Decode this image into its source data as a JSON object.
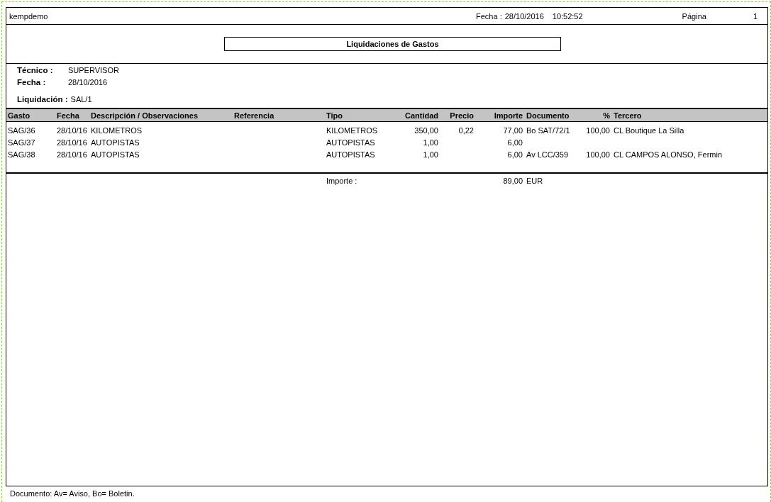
{
  "header": {
    "company": "kempdemo",
    "date_label": "Fecha :",
    "date": "28/10/2016",
    "time": "10:52:52",
    "page_label": "Página",
    "page": "1"
  },
  "title": "Liquidaciones de Gastos",
  "info": [
    {
      "label": "Técnico :",
      "value": "SUPERVISOR"
    },
    {
      "label": "Fecha :",
      "value": "28/10/2016"
    },
    {
      "label": "Liquidación :",
      "value": "SAL/1"
    }
  ],
  "table": {
    "columns": [
      "Gasto",
      "Fecha",
      "Descripción / Observaciones",
      "Referencia",
      "Tipo",
      "Cantidad",
      "Precio",
      "Importe",
      "Documento",
      "%",
      "Tercero"
    ],
    "rows": [
      [
        "SAG/36",
        "28/10/16",
        "KILOMETROS",
        null,
        "KILOMETROS",
        "350,00",
        "0,22",
        "77,00",
        "Bo SAT/72/1",
        "100,00",
        "CL Boutique La Silla"
      ],
      [
        "SAG/37",
        "28/10/16",
        "AUTOPISTAS",
        null,
        "AUTOPISTAS",
        "1,00",
        null,
        "6,00",
        null,
        null,
        null
      ],
      [
        "SAG/38",
        "28/10/16",
        "AUTOPISTAS",
        null,
        "AUTOPISTAS",
        "1,00",
        null,
        "6,00",
        "Av LCC/359",
        "100,00",
        "CL CAMPOS ALONSO, Fermin"
      ]
    ]
  },
  "total": {
    "label": "Importe :",
    "amount": "89,00",
    "currency": "EUR"
  },
  "footnote": "Documento: Av= Aviso, Bo= Boletin."
}
